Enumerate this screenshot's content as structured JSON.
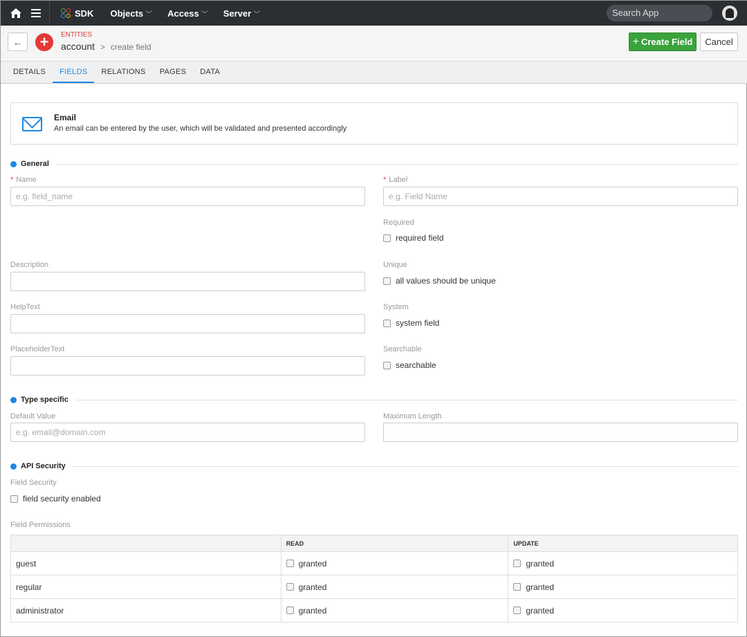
{
  "nav": {
    "app": "SDK",
    "menus": [
      {
        "label": "Objects"
      },
      {
        "label": "Access"
      },
      {
        "label": "Server"
      }
    ],
    "search_placeholder": "Search App"
  },
  "header": {
    "section": "ENTITIES",
    "entity": "account",
    "page": "create field",
    "create_label": "Create Field",
    "cancel_label": "Cancel"
  },
  "tabs": [
    {
      "label": "DETAILS",
      "active": false
    },
    {
      "label": "FIELDS",
      "active": true
    },
    {
      "label": "RELATIONS",
      "active": false
    },
    {
      "label": "PAGES",
      "active": false
    },
    {
      "label": "DATA",
      "active": false
    }
  ],
  "field_type": {
    "title": "Email",
    "description": "An email can be entered by the user, which will be validated and presented accordingly"
  },
  "general": {
    "heading": "General",
    "name": {
      "label": "Name",
      "placeholder": "e.g. field_name",
      "required": true
    },
    "label": {
      "label": "Label",
      "placeholder": "e.g. Field Name",
      "required": true
    },
    "required": {
      "label": "Required",
      "option": "required field",
      "checked": false
    },
    "description": {
      "label": "Description",
      "value": ""
    },
    "unique": {
      "label": "Unique",
      "option": "all values should be unique",
      "checked": false
    },
    "helptext": {
      "label": "HelpText",
      "value": ""
    },
    "system": {
      "label": "System",
      "option": "system field",
      "checked": false
    },
    "placeholdertext": {
      "label": "PlaceholderText",
      "value": ""
    },
    "searchable": {
      "label": "Searchable",
      "option": "searchable",
      "checked": false
    }
  },
  "type_specific": {
    "heading": "Type specific",
    "default_value": {
      "label": "Default Value",
      "placeholder": "e.g. email@domain.com"
    },
    "max_length": {
      "label": "Maximum Length",
      "value": ""
    }
  },
  "api_security": {
    "heading": "API Security",
    "field_security": {
      "label": "Field Security",
      "option": "field security enabled",
      "checked": false
    },
    "permissions_label": "Field Permissions",
    "columns": [
      "",
      "READ",
      "UPDATE"
    ],
    "rows": [
      {
        "role": "guest",
        "read": "granted",
        "update": "granted"
      },
      {
        "role": "regular",
        "read": "granted",
        "update": "granted"
      },
      {
        "role": "administrator",
        "read": "granted",
        "update": "granted"
      }
    ]
  },
  "colors": {
    "accent": "#1e88e5",
    "primary_button": "#3aa33c",
    "danger": "#e53935",
    "nav_bg": "#2b2e33"
  }
}
